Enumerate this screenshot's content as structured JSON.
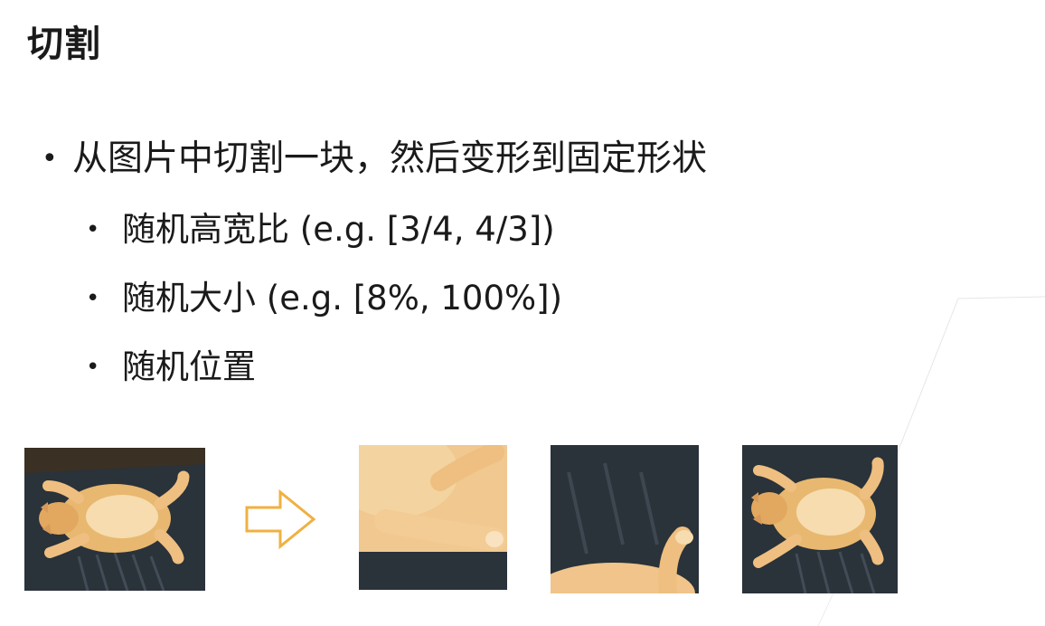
{
  "slide": {
    "title": "切割",
    "bullet": "从图片中切割一块，然后变形到固定形状",
    "sub_bullets": [
      "随机高宽比 (e.g. [3/4, 4/3])",
      "随机大小 (e.g. [8%, 100%])",
      "随机位置"
    ]
  },
  "figures": {
    "source": "cat-original-photo",
    "arrow": "right-arrow-icon",
    "crops": [
      "cat-crop-1",
      "cat-crop-2",
      "cat-crop-3"
    ]
  },
  "colors": {
    "arrow": "#f0b040",
    "text": "#1a1a1a",
    "fur": "#e8b870",
    "background_blanket": "#2a323a"
  }
}
